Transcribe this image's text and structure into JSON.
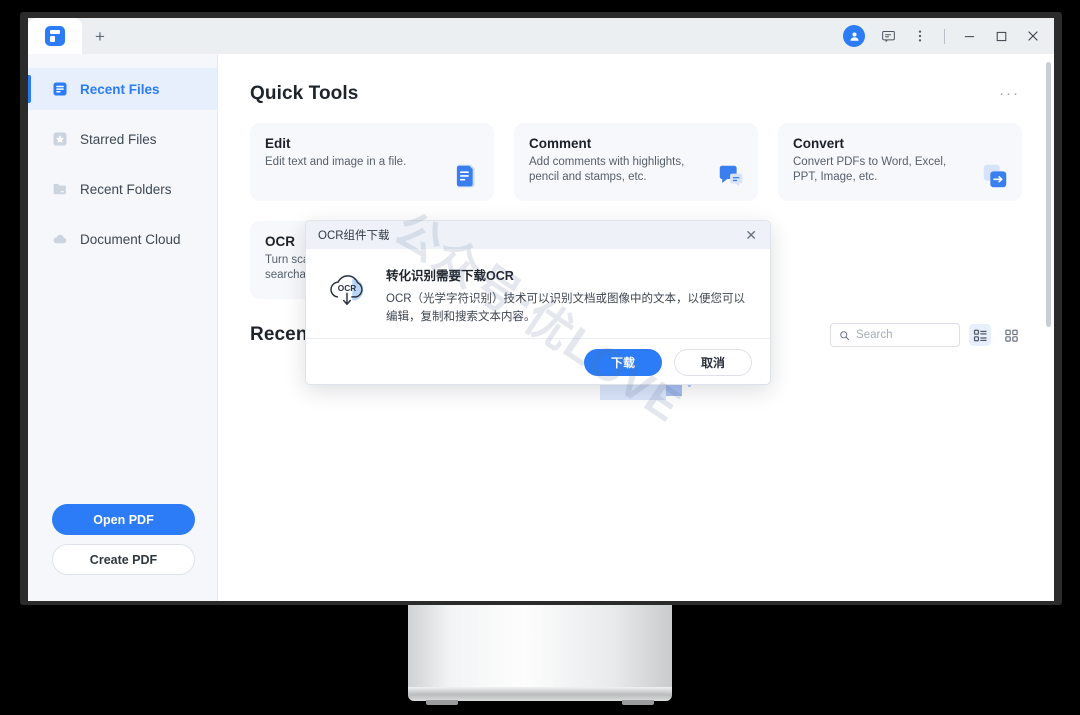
{
  "window": {
    "tab_new_label": "+",
    "logo_name": "pdf-app-logo",
    "controls": {
      "account": "account-avatar",
      "feedback": "feedback-icon",
      "more": "more-vertical-icon",
      "minimize": "—",
      "maximize": "□",
      "close": "✕"
    }
  },
  "sidebar": {
    "items": [
      {
        "label": "Recent Files",
        "icon": "recent-files-icon",
        "active": true
      },
      {
        "label": "Starred Files",
        "icon": "starred-files-icon",
        "active": false
      },
      {
        "label": "Recent Folders",
        "icon": "recent-folders-icon",
        "active": false
      },
      {
        "label": "Document Cloud",
        "icon": "document-cloud-icon",
        "active": false
      }
    ],
    "open_pdf_label": "Open PDF",
    "create_pdf_label": "Create PDF"
  },
  "main": {
    "quick_tools_title": "Quick Tools",
    "more_dots": "···",
    "tools": [
      {
        "title": "Edit",
        "desc": "Edit text and image in a file.",
        "icon": "edit-document-icon"
      },
      {
        "title": "Comment",
        "desc": "Add comments with highlights, pencil and stamps, etc.",
        "icon": "comment-bubble-icon"
      },
      {
        "title": "Convert",
        "desc": "Convert PDFs to Word, Excel, PPT, Image, etc.",
        "icon": "convert-arrow-icon"
      },
      {
        "title": "OCR",
        "desc": "Turn scanned PDFs into searchable text.",
        "icon": "ocr-scan-icon"
      }
    ],
    "recent_title": "Recent",
    "search_placeholder": "Search",
    "search_value": "",
    "view_list_label": "list-view",
    "view_grid_label": "grid-view",
    "empty_illustration": "empty-box-illustration"
  },
  "modal": {
    "title": "OCR组件下载",
    "close_label": "✕",
    "icon": "ocr-cloud-download-icon",
    "icon_text": "OCR",
    "heading": "转化识别需要下载OCR",
    "body": "OCR（光学字符识别）技术可以识别文档或图像中的文本，以便您可以编辑，复制和搜索文本内容。",
    "download_label": "下载",
    "cancel_label": "取消"
  },
  "watermark": {
    "text": "公众号:优LOVE"
  },
  "colors": {
    "accent": "#2b7cf6",
    "sidebar_bg": "#f5f7fa",
    "card_bg": "#f7f8fb",
    "titlebar_bg": "#eceff1"
  }
}
